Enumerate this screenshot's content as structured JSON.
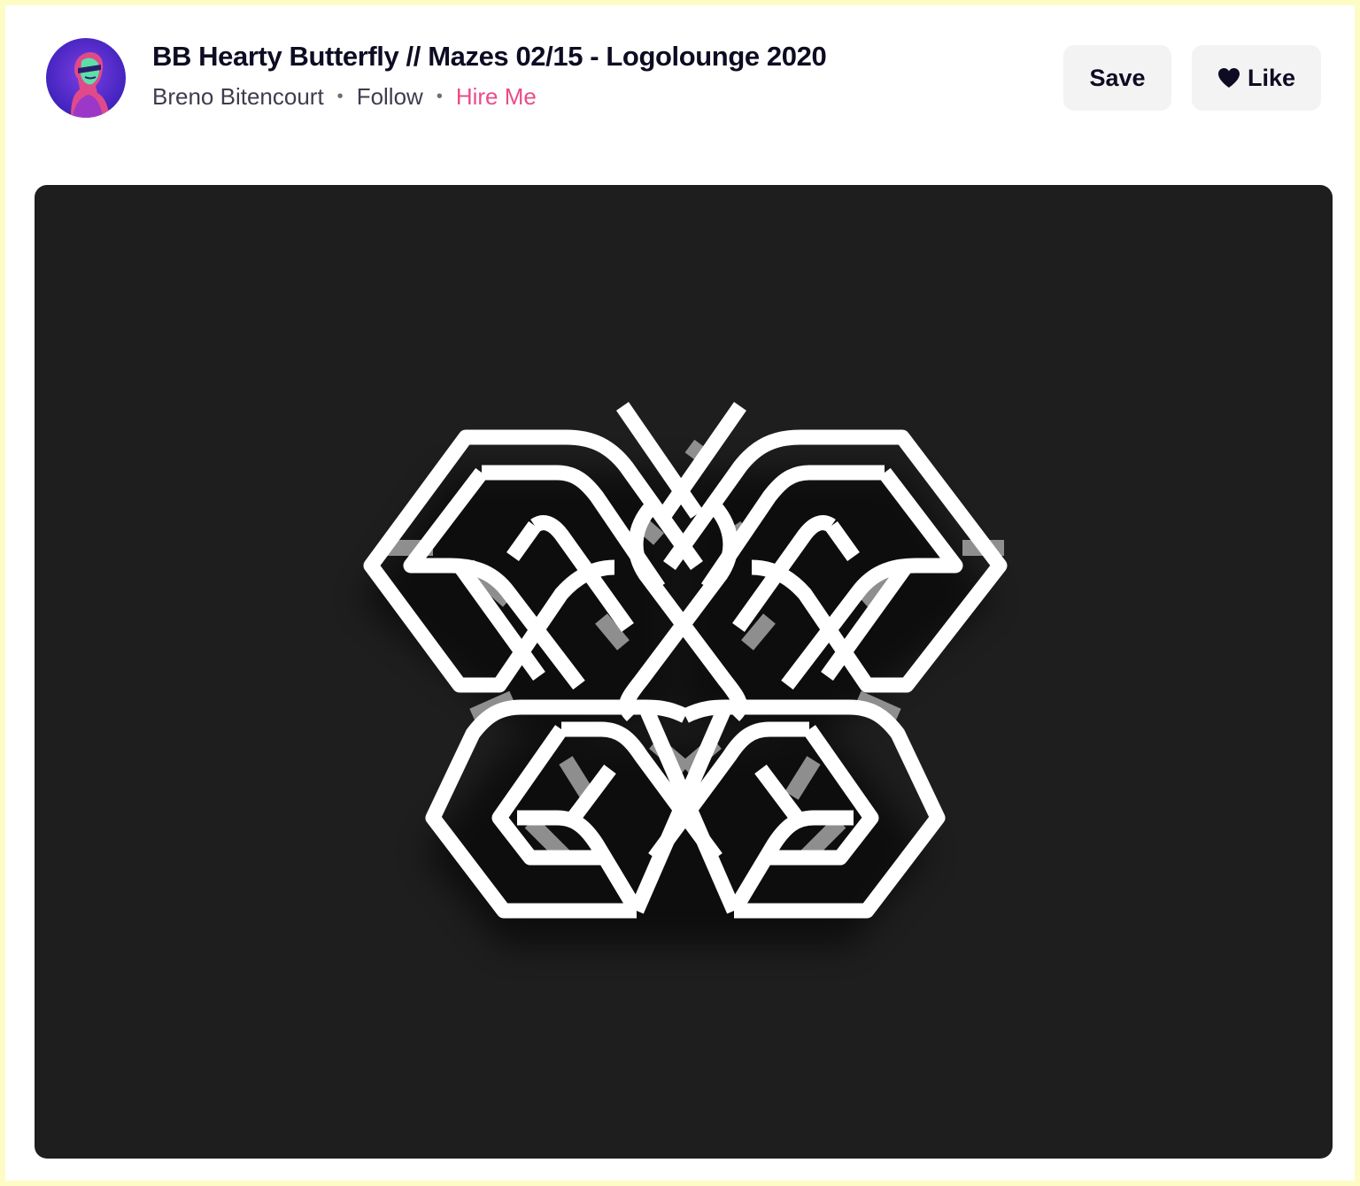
{
  "shot": {
    "title": "BB Hearty Butterfly // Mazes 02/15 - Logolounge 2020",
    "author": "Breno Bitencourt",
    "separator": "•",
    "follow_label": "Follow",
    "hire_label": "Hire Me"
  },
  "actions": {
    "save_label": "Save",
    "like_label": "Like",
    "like_icon": "heart-icon"
  },
  "colors": {
    "accent_pink": "#ea4c89",
    "page_border": "#fdfcc4",
    "shot_background": "#1e1e1e"
  }
}
